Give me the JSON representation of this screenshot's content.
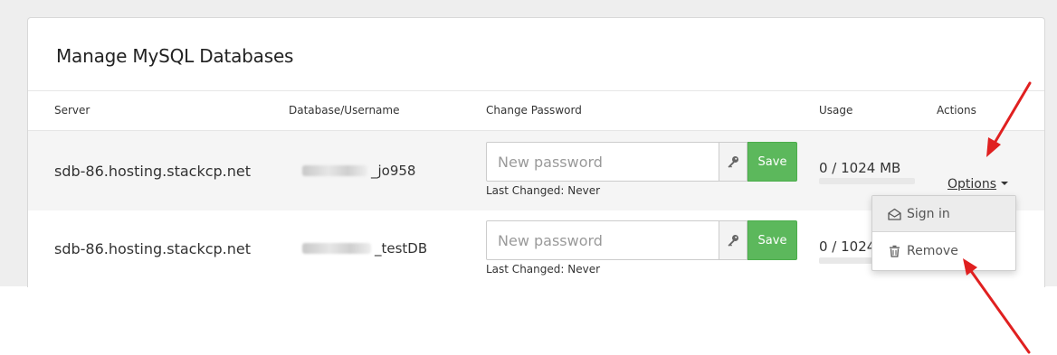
{
  "panel": {
    "title": "Manage MySQL Databases"
  },
  "columns": {
    "server": "Server",
    "database": "Database/Username",
    "password": "Change Password",
    "usage": "Usage",
    "actions": "Actions"
  },
  "rows": [
    {
      "server": "sdb-86.hosting.stackcp.net",
      "db_suffix": "_jo958",
      "password_placeholder": "New password",
      "save_label": "Save",
      "last_changed": "Last Changed: Never",
      "usage": "0 / 1024 MB",
      "usage_fraction": 0,
      "options_label": "Options"
    },
    {
      "server": "sdb-86.hosting.stackcp.net",
      "db_suffix": "_testDB",
      "password_placeholder": "New password",
      "save_label": "Save",
      "last_changed": "Last Changed: Never",
      "usage": "0 / 1024",
      "usage_fraction": 0
    }
  ],
  "dropdown": {
    "items": [
      {
        "label": "Sign in",
        "icon": "envelope-open-icon"
      },
      {
        "label": "Remove",
        "icon": "trash-icon"
      }
    ]
  },
  "colors": {
    "save_green": "#5cb85c",
    "annotation_red": "#e02020"
  }
}
